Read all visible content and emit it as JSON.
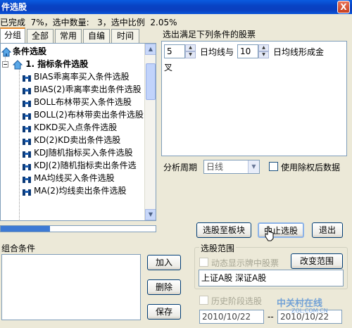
{
  "window": {
    "title": "件选股",
    "close_glyph": "X"
  },
  "status": {
    "text": "已完成  7%，选中数量:   3，选中比例  2.05%"
  },
  "tabs": [
    "分组",
    "全部",
    "常用",
    "自编",
    "时间"
  ],
  "tree": {
    "root": "条件选股",
    "group": "1. 指标条件选股",
    "items": [
      "BIAS乖离率买入条件选股",
      "BIAS(2)乖离率卖出条件选股",
      "BOLL布林带买入条件选股",
      "BOLL(2)布林带卖出条件选股",
      "KDKD买入点条件选股",
      "KD(2)KD卖出条件选股",
      "KDJ随机指标买入条件选股",
      "KDJ(2)随机指标卖出条件选",
      "MA均线买入条件选股",
      "MA(2)均线卖出条件选股"
    ],
    "progress_percent": 32
  },
  "condition": {
    "title": "选出满足下列条件的股票",
    "value1": "5",
    "label1": "日均线与",
    "value2": "10",
    "label2": "日均线形成金",
    "wrap": "叉"
  },
  "period": {
    "label": "分析周期",
    "value": "日线",
    "adjust_label": "使用除权后数据"
  },
  "buttons": {
    "to_block": "选股至板块",
    "stop": "中止选股",
    "exit": "退出",
    "add": "加入",
    "delete": "删除",
    "save": "保存",
    "change_range": "改变范围"
  },
  "combo": {
    "label": "组合条件"
  },
  "range": {
    "label": "选股范围",
    "dynamic_label": "动态显示牌中股票",
    "markets": "上证A股  深证A股"
  },
  "history": {
    "label": "历史阶段选股",
    "from": "2010/10/22",
    "to": "2010/10/22",
    "sep": "--"
  },
  "watermark": {
    "text": "中关村在线",
    "sub": "ZOL.COM.CN"
  }
}
